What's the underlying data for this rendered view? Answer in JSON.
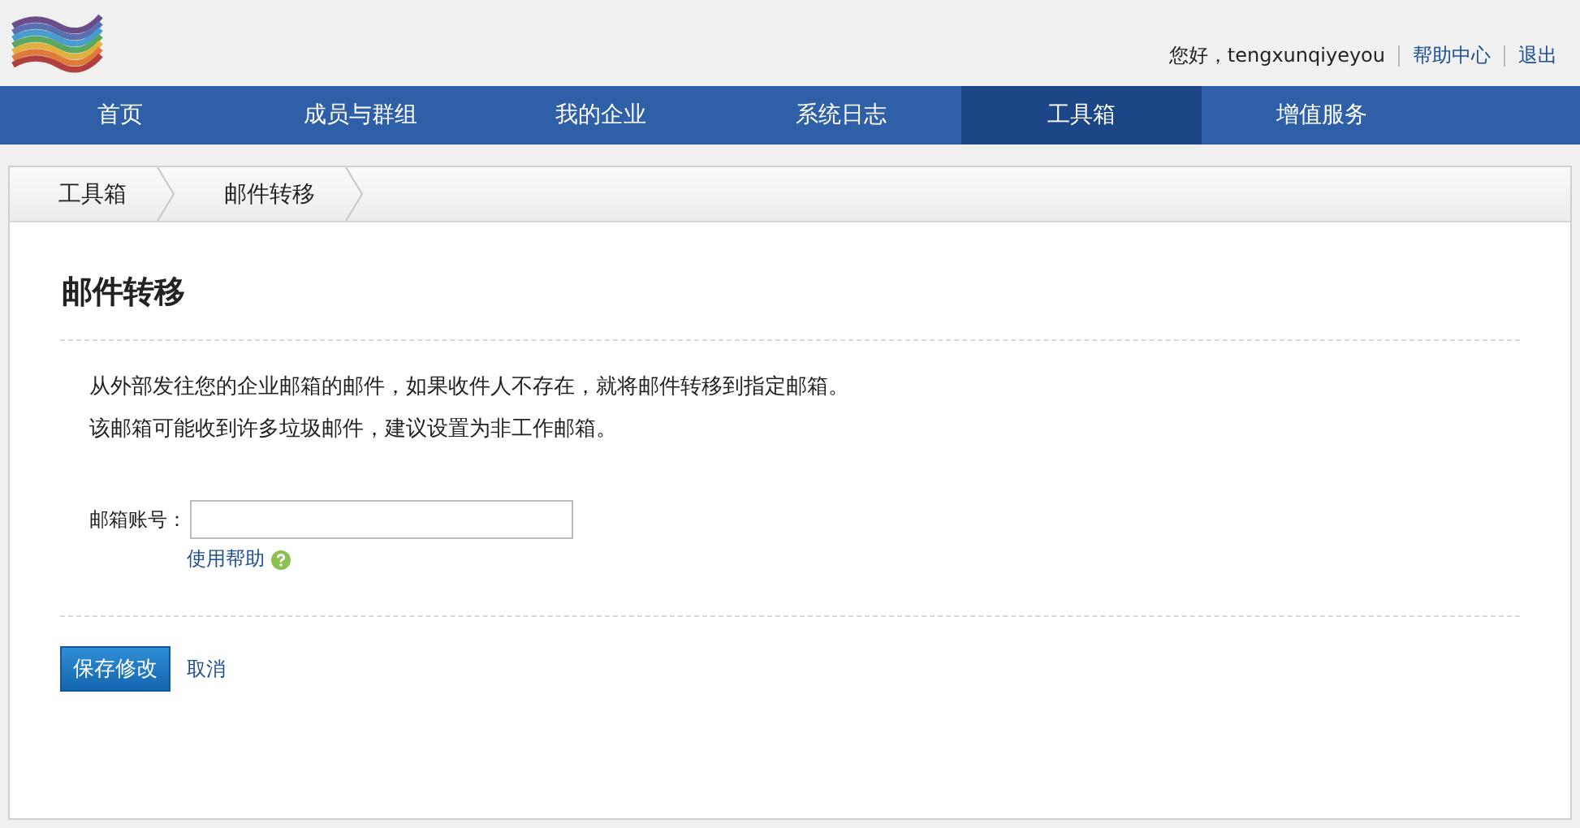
{
  "header": {
    "greeting": "您好，tengxunqiyeyou",
    "links": [
      "帮助中心",
      "退出"
    ]
  },
  "nav": [
    {
      "label": "首页",
      "selected": false
    },
    {
      "label": "成员与群组",
      "selected": false
    },
    {
      "label": "我的企业",
      "selected": false
    },
    {
      "label": "系统日志",
      "selected": false
    },
    {
      "label": "工具箱",
      "selected": true
    },
    {
      "label": "增值服务",
      "selected": false
    }
  ],
  "breadcrumb": [
    "工具箱",
    "邮件转移"
  ],
  "page": {
    "title": "邮件转移",
    "description": [
      "从外部发往您的企业邮箱的邮件，如果收件人不存在，就将邮件转移到指定邮箱。",
      "该邮箱可能收到许多垃圾邮件，建议设置为非工作邮箱。"
    ],
    "field": {
      "label": "邮箱账号：",
      "help": "使用帮助"
    },
    "buttons": {
      "save": "保存修改",
      "cancel": "取消"
    }
  }
}
